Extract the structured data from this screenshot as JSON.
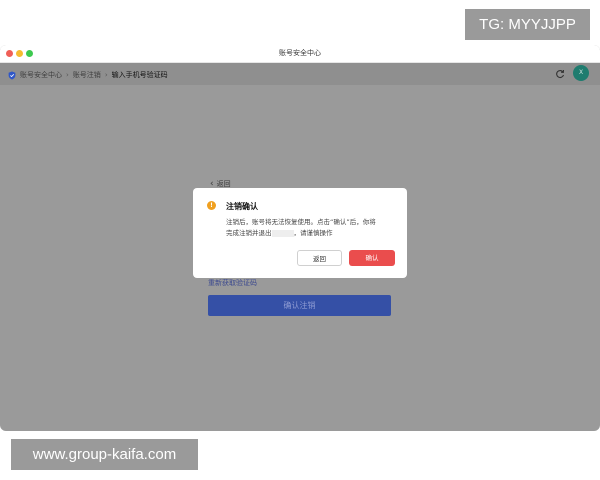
{
  "window": {
    "title": "账号安全中心"
  },
  "breadcrumb": {
    "items": [
      "账号安全中心",
      "账号注销",
      "输入手机号验证码"
    ]
  },
  "avatar": {
    "initial": "X"
  },
  "page": {
    "back_label": "返回",
    "resend_label": "重新获取验证码",
    "confirm_cancel_label": "确认注销"
  },
  "modal": {
    "icon_glyph": "!",
    "title": "注销确认",
    "body_line1": "注销后，账号将无法恢复使用。点击“确认”后，你将",
    "body_line2_prefix": "完成注销并退出",
    "body_line2_suffix": "，请谨慎操作",
    "back_button": "返回",
    "confirm_button": "确认"
  },
  "watermarks": {
    "top": "TG: MYYJJPP",
    "bottom": "www.group-kaifa.com"
  },
  "colors": {
    "accent": "#3550a6",
    "danger": "#ea4d4d",
    "warning": "#f0a020",
    "overlay": "#9a9a9a"
  },
  "icons": [
    "shield-icon",
    "chevron-right-icon",
    "refresh-icon",
    "chevron-left-icon",
    "warning-icon"
  ]
}
